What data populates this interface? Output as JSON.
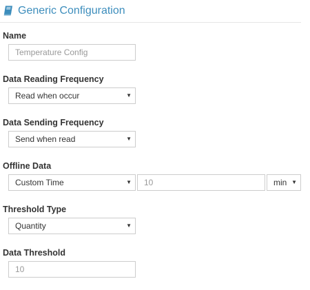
{
  "header": {
    "title": "Generic Configuration",
    "icon": "book-icon",
    "accent_color": "#3c8dbc"
  },
  "form": {
    "name": {
      "label": "Name",
      "placeholder": "Temperature Config"
    },
    "data_reading_frequency": {
      "label": "Data Reading Frequency",
      "selected": "Read when occur"
    },
    "data_sending_frequency": {
      "label": "Data Sending Frequency",
      "selected": "Send when read"
    },
    "offline_data": {
      "label": "Offline Data",
      "mode_selected": "Custom Time",
      "value_placeholder": "10",
      "unit_selected": "min"
    },
    "threshold_type": {
      "label": "Threshold Type",
      "selected": "Quantity"
    },
    "data_threshold": {
      "label": "Data Threshold",
      "placeholder": "10"
    }
  },
  "icons": {
    "caret": "▼"
  }
}
